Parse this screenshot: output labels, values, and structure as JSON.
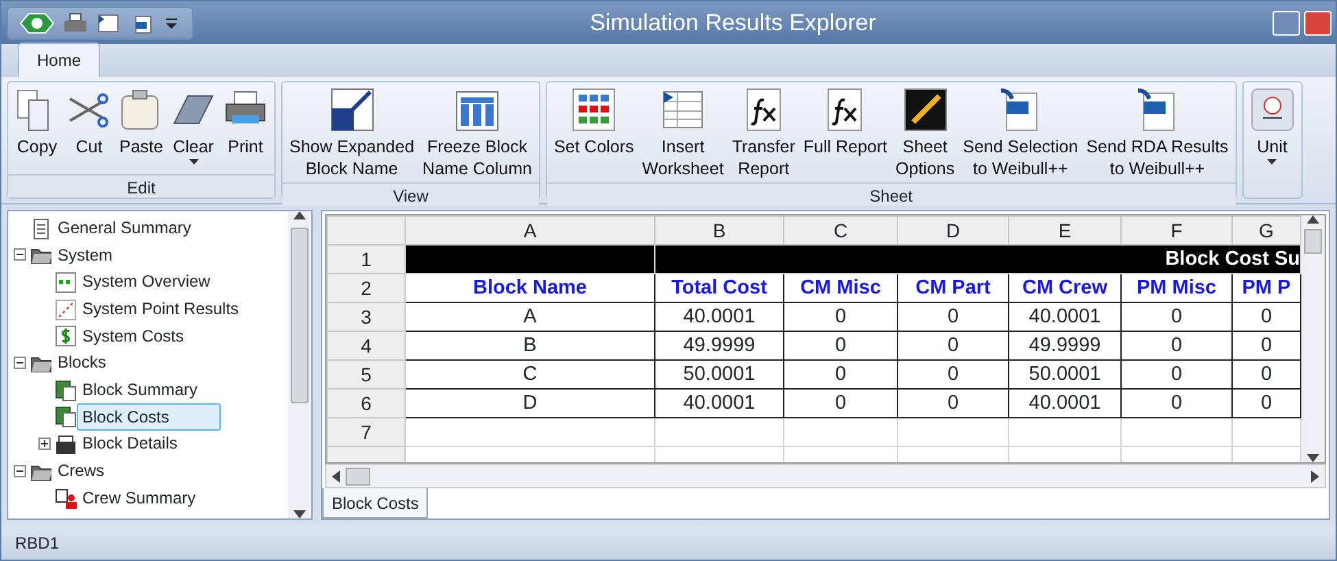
{
  "window": {
    "title": "Simulation Results Explorer"
  },
  "tabs": [
    {
      "label": "Home",
      "selected": true
    }
  ],
  "ribbon": {
    "groups": [
      {
        "label": "Edit",
        "buttons": [
          {
            "label": "Copy",
            "dropdown": false
          },
          {
            "label": "Cut",
            "dropdown": false
          },
          {
            "label": "Paste",
            "dropdown": false
          },
          {
            "label": "Clear",
            "dropdown": true
          },
          {
            "label": "Print",
            "dropdown": false
          }
        ]
      },
      {
        "label": "View",
        "buttons": [
          {
            "label": "Show Expanded\nBlock Name",
            "dropdown": false
          },
          {
            "label": "Freeze Block\nName Column",
            "dropdown": false
          }
        ]
      },
      {
        "label": "Sheet",
        "buttons": [
          {
            "label": "Set Colors",
            "dropdown": false
          },
          {
            "label": "Insert\nWorksheet",
            "dropdown": false
          },
          {
            "label": "Transfer\nReport",
            "dropdown": false
          },
          {
            "label": "Full Report",
            "dropdown": false
          },
          {
            "label": "Sheet\nOptions",
            "dropdown": false
          },
          {
            "label": "Send Selection\nto Weibull++",
            "dropdown": false
          },
          {
            "label": "Send RDA Results\nto Weibull++",
            "dropdown": false
          }
        ]
      },
      {
        "buttons": [
          {
            "label": "Unit",
            "dropdown": true
          }
        ]
      }
    ]
  },
  "tree": {
    "items": [
      {
        "label": "General Summary",
        "selected": false
      },
      {
        "label": "System",
        "selected": false,
        "expanded": true,
        "children": [
          {
            "label": "System Overview",
            "selected": false
          },
          {
            "label": "System Point Results",
            "selected": false
          },
          {
            "label": "System Costs",
            "selected": false
          }
        ]
      },
      {
        "label": "Blocks",
        "selected": false,
        "expanded": true,
        "children": [
          {
            "label": "Block Summary",
            "selected": false
          },
          {
            "label": "Block Costs",
            "selected": true
          },
          {
            "label": "Block Details",
            "selected": false,
            "expanded": false
          }
        ]
      },
      {
        "label": "Crews",
        "selected": false,
        "expanded": true,
        "children": [
          {
            "label": "Crew Summary",
            "selected": false
          }
        ]
      }
    ]
  },
  "sheet": {
    "columns": [
      "A",
      "B",
      "C",
      "D",
      "E",
      "F",
      "G"
    ],
    "title_row": {
      "row": "1",
      "text": "Block Cost Su"
    },
    "header_row": {
      "row": "2",
      "cells": [
        "Block Name",
        "Total Cost",
        "CM Misc",
        "CM Part",
        "CM Crew",
        "PM Misc",
        "PM P"
      ]
    },
    "rows": [
      {
        "row": "3",
        "cells": [
          "A",
          "40.0001",
          "0",
          "0",
          "40.0001",
          "0",
          "0"
        ]
      },
      {
        "row": "4",
        "cells": [
          "B",
          "49.9999",
          "0",
          "0",
          "49.9999",
          "0",
          "0"
        ]
      },
      {
        "row": "5",
        "cells": [
          "C",
          "50.0001",
          "0",
          "0",
          "50.0001",
          "0",
          "0"
        ]
      },
      {
        "row": "6",
        "cells": [
          "D",
          "40.0001",
          "0",
          "0",
          "40.0001",
          "0",
          "0"
        ]
      },
      {
        "row": "7"
      }
    ],
    "tabs": [
      {
        "label": "Block Costs",
        "selected": true
      }
    ]
  },
  "status_bar": {
    "text": "RBD1"
  }
}
